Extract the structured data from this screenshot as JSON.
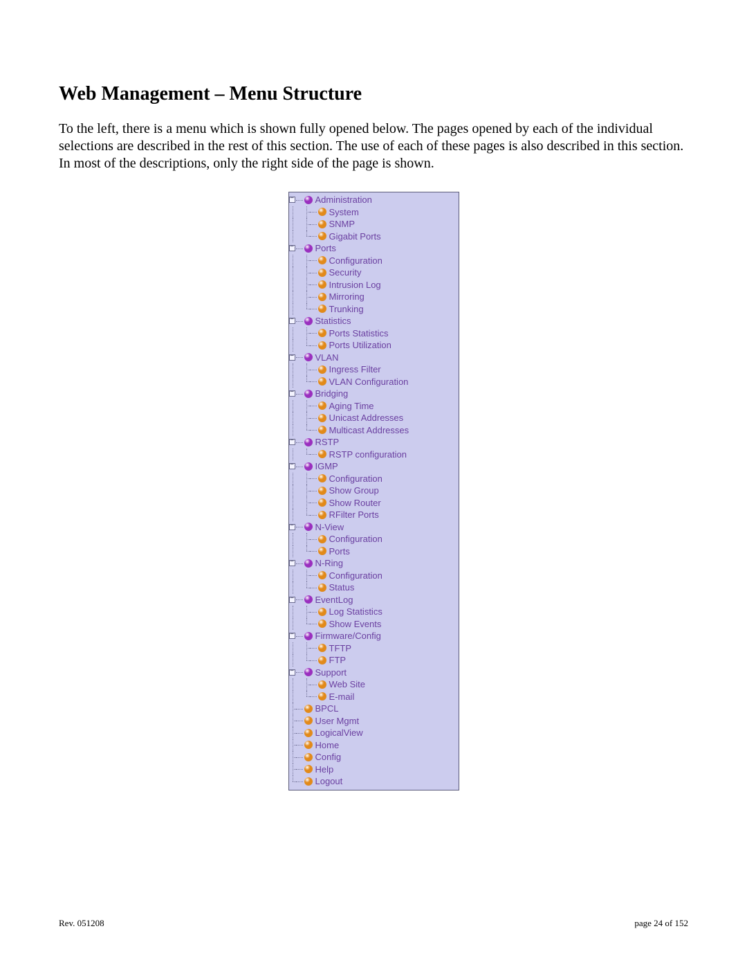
{
  "title": "Web Management – Menu Structure",
  "paragraph": "To the left, there is a menu which is shown fully opened below.  The pages opened by each of the individual selections are described in the rest of this section.  The use of each of these pages is also described in this section.  In most of the descriptions, only the right side of the page is shown.",
  "footer": {
    "left": "Rev.  051208",
    "right": "page 24 of 152"
  },
  "menu": [
    {
      "label": "Administration",
      "type": "parent",
      "children": [
        {
          "label": "System"
        },
        {
          "label": "SNMP"
        },
        {
          "label": "Gigabit Ports"
        }
      ]
    },
    {
      "label": "Ports",
      "type": "parent",
      "children": [
        {
          "label": "Configuration"
        },
        {
          "label": "Security"
        },
        {
          "label": "Intrusion Log"
        },
        {
          "label": "Mirroring"
        },
        {
          "label": "Trunking"
        }
      ]
    },
    {
      "label": "Statistics",
      "type": "parent",
      "children": [
        {
          "label": "Ports Statistics"
        },
        {
          "label": "Ports Utilization"
        }
      ]
    },
    {
      "label": "VLAN",
      "type": "parent",
      "children": [
        {
          "label": "Ingress Filter"
        },
        {
          "label": "VLAN Configuration"
        }
      ]
    },
    {
      "label": "Bridging",
      "type": "parent",
      "children": [
        {
          "label": "Aging Time"
        },
        {
          "label": "Unicast Addresses"
        },
        {
          "label": "Multicast Addresses"
        }
      ]
    },
    {
      "label": "RSTP",
      "type": "parent",
      "children": [
        {
          "label": "RSTP configuration"
        }
      ]
    },
    {
      "label": "IGMP",
      "type": "parent",
      "children": [
        {
          "label": "Configuration"
        },
        {
          "label": "Show Group"
        },
        {
          "label": "Show Router"
        },
        {
          "label": "RFilter Ports"
        }
      ]
    },
    {
      "label": "N-View",
      "type": "parent",
      "children": [
        {
          "label": "Configuration"
        },
        {
          "label": "Ports"
        }
      ]
    },
    {
      "label": "N-Ring",
      "type": "parent",
      "children": [
        {
          "label": "Configuration"
        },
        {
          "label": "Status"
        }
      ]
    },
    {
      "label": "EventLog",
      "type": "parent",
      "children": [
        {
          "label": "Log Statistics"
        },
        {
          "label": "Show Events"
        }
      ]
    },
    {
      "label": "Firmware/Config",
      "type": "parent",
      "children": [
        {
          "label": "TFTP"
        },
        {
          "label": "FTP"
        }
      ]
    },
    {
      "label": "Support",
      "type": "parent",
      "children": [
        {
          "label": "Web Site"
        },
        {
          "label": "E-mail"
        }
      ]
    },
    {
      "label": "BPCL",
      "type": "leaf"
    },
    {
      "label": "User Mgmt",
      "type": "leaf"
    },
    {
      "label": "LogicalView",
      "type": "leaf"
    },
    {
      "label": "Home",
      "type": "leaf"
    },
    {
      "label": "Config",
      "type": "leaf"
    },
    {
      "label": "Help",
      "type": "leaf"
    },
    {
      "label": "Logout",
      "type": "leaf"
    }
  ]
}
